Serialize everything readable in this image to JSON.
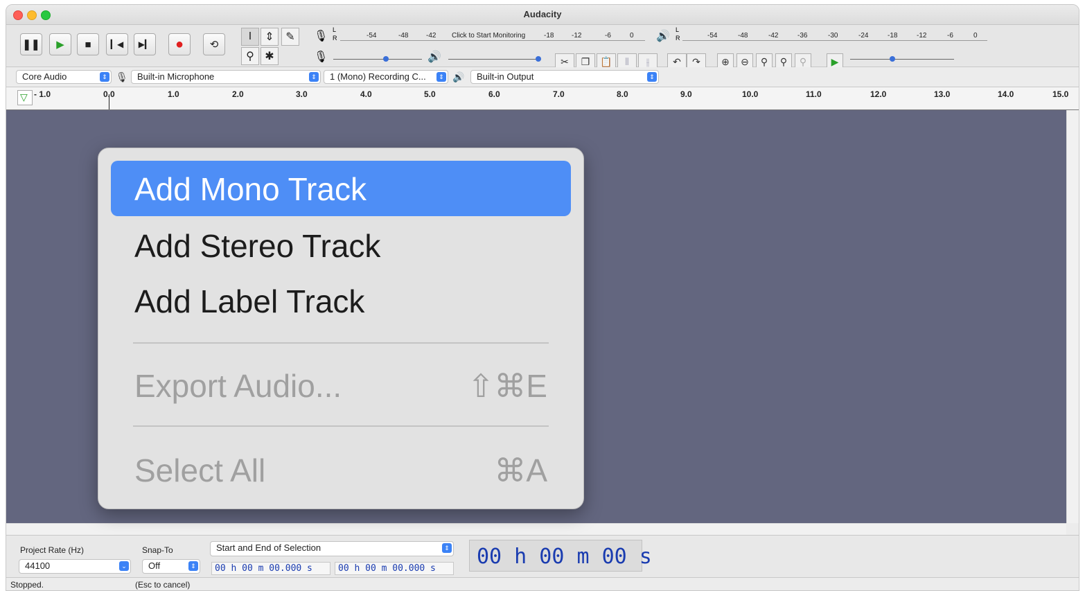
{
  "window": {
    "title": "Audacity"
  },
  "transport": {
    "pause_icon": "pause-icon",
    "play_icon": "play-icon",
    "stop_icon": "stop-icon",
    "skip_start_icon": "skip-start-icon",
    "skip_end_icon": "skip-end-icon",
    "record_icon": "record-icon",
    "loop_icon": "loop-icon",
    "record_color": "#e02020",
    "play_color": "#2aa02a"
  },
  "meters": {
    "record_scale": [
      "-54",
      "-48",
      "-42",
      "Click to Start Monitoring",
      "-18",
      "-12",
      "-6",
      "0"
    ],
    "playback_scale": [
      "-54",
      "-48",
      "-42",
      "-36",
      "-30",
      "-24",
      "-18",
      "-12",
      "-6",
      "0"
    ],
    "channel_labels": [
      "L",
      "R"
    ],
    "record_volume": 0.6,
    "playback_volume": 1.0,
    "play_speed": 0.4
  },
  "devices": {
    "host": "Core Audio",
    "input_device": "Built-in Microphone",
    "channels": "1 (Mono) Recording C...",
    "output_device": "Built-in Output"
  },
  "ruler": {
    "ticks": [
      "- 1.0",
      "0.0",
      "1.0",
      "2.0",
      "3.0",
      "4.0",
      "5.0",
      "6.0",
      "7.0",
      "8.0",
      "9.0",
      "10.0",
      "11.0",
      "12.0",
      "13.0",
      "14.0",
      "15.0"
    ]
  },
  "context_menu": {
    "items": [
      {
        "label": "Add Mono Track",
        "shortcut": "",
        "highlighted": true,
        "disabled": false
      },
      {
        "label": "Add Stereo Track",
        "shortcut": "",
        "highlighted": false,
        "disabled": false
      },
      {
        "label": "Add Label Track",
        "shortcut": "",
        "highlighted": false,
        "disabled": false
      },
      {
        "label": "Export Audio...",
        "shortcut": "⇧⌘E",
        "highlighted": false,
        "disabled": true
      },
      {
        "label": "Select All",
        "shortcut": "⌘A",
        "highlighted": false,
        "disabled": true
      }
    ]
  },
  "selection_toolbar": {
    "project_rate_label": "Project Rate (Hz)",
    "project_rate_value": "44100",
    "snap_label": "Snap-To",
    "snap_value": "Off",
    "selection_mode": "Start and End of Selection",
    "start_time": "00 h 00 m 00.000 s",
    "end_time": "00 h 00 m 00.000 s",
    "audio_position": "00 h 00 m 00 s"
  },
  "status": {
    "state": "Stopped.",
    "hint": "(Esc to cancel)"
  }
}
